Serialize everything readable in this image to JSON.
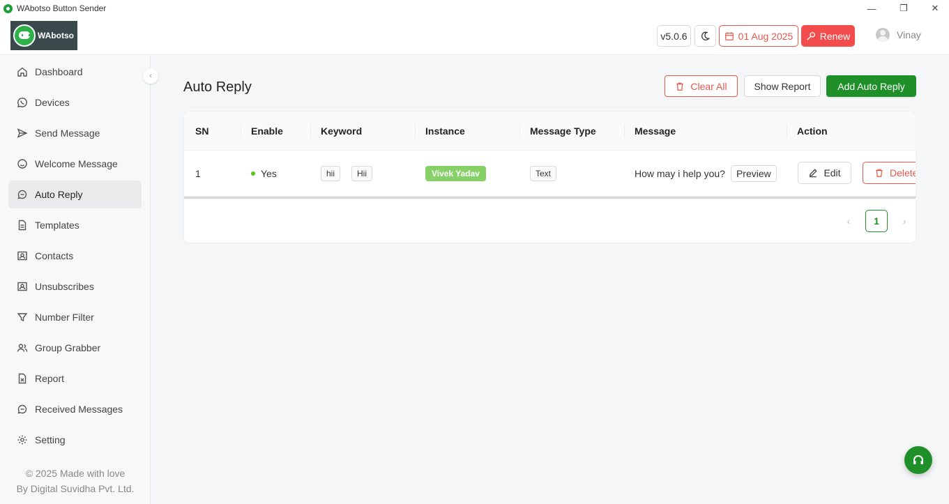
{
  "window": {
    "title": "WAbotso Button Sender",
    "controls": [
      "—",
      "❐",
      "✕"
    ]
  },
  "header": {
    "logo_text": "WAbotso",
    "version": "v5.0.6",
    "theme_icon": "moon-icon",
    "expiry_date": "01 Aug 2025",
    "renew_label": "Renew",
    "user_name": "Vinay",
    "colors": {
      "accent_red": "#f24c4c",
      "brand_green": "#1f8f2a"
    }
  },
  "sidebar": {
    "items": [
      {
        "label": "Dashboard",
        "icon": "home-icon"
      },
      {
        "label": "Devices",
        "icon": "whatsapp-icon"
      },
      {
        "label": "Send Message",
        "icon": "send-icon"
      },
      {
        "label": "Welcome Message",
        "icon": "smile-icon"
      },
      {
        "label": "Auto Reply",
        "icon": "chat-icon",
        "active": true
      },
      {
        "label": "Templates",
        "icon": "file-icon"
      },
      {
        "label": "Contacts",
        "icon": "contacts-icon"
      },
      {
        "label": "Unsubscribes",
        "icon": "contacts-icon"
      },
      {
        "label": "Number Filter",
        "icon": "filter-icon"
      },
      {
        "label": "Group Grabber",
        "icon": "group-icon"
      },
      {
        "label": "Report",
        "icon": "report-icon"
      },
      {
        "label": "Received Messages",
        "icon": "chat-icon"
      },
      {
        "label": "Setting",
        "icon": "gear-icon"
      }
    ],
    "footer_line1": "© 2025 Made with love",
    "footer_line2": "By Digital Suvidha Pvt. Ltd."
  },
  "main": {
    "title": "Auto Reply",
    "clear_all_label": "Clear All",
    "show_report_label": "Show Report",
    "add_label": "Add Auto Reply",
    "table": {
      "columns": [
        "SN",
        "Enable",
        "Keyword",
        "Instance",
        "Message Type",
        "Message",
        "Action"
      ],
      "rows": [
        {
          "sn": "1",
          "enable": "Yes",
          "keywords": [
            "hii",
            "Hii"
          ],
          "instance": "Vivek Yadav",
          "message_type": "Text",
          "message": "How may i help you?",
          "preview_label": "Preview",
          "edit_label": "Edit",
          "delete_label": "Delete"
        }
      ]
    },
    "pagination": {
      "prev": "‹",
      "current": "1",
      "next": "›"
    }
  }
}
